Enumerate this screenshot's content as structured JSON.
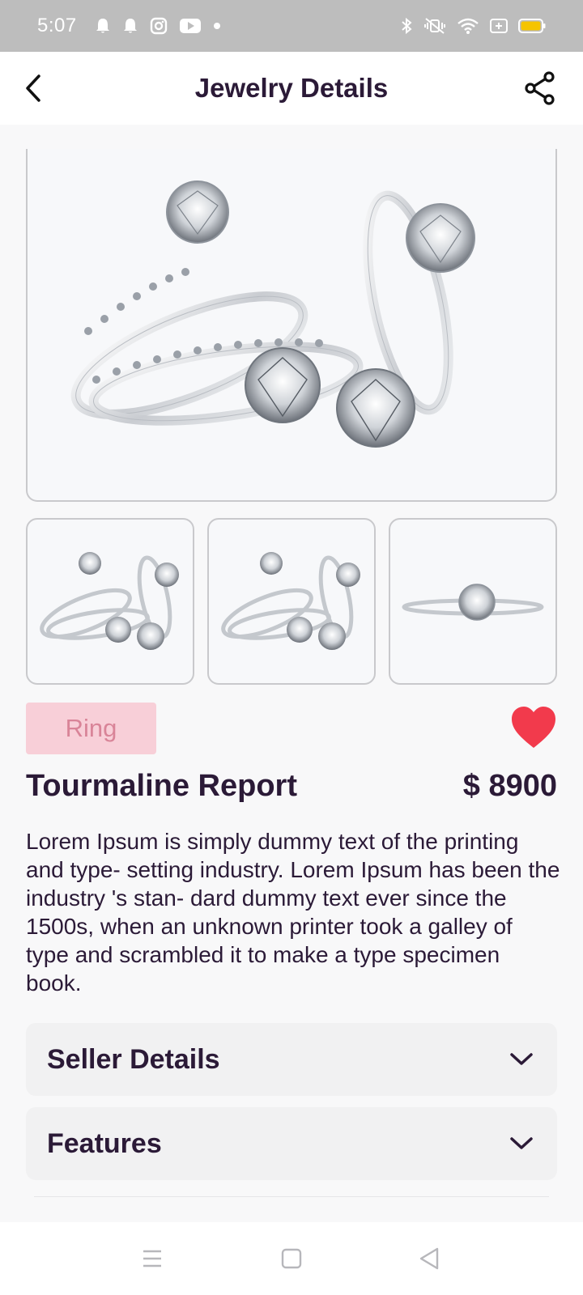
{
  "status_bar": {
    "time": "5:07",
    "left_icons": [
      "bell-icon",
      "bell-icon",
      "instagram-icon",
      "youtube-icon",
      "dot-icon"
    ],
    "right_icons": [
      "bluetooth-icon",
      "vibrate-off-icon",
      "wifi-icon",
      "sim-icon",
      "battery-icon"
    ],
    "battery_color": "#f5c400"
  },
  "app_bar": {
    "title": "Jewelry Details",
    "back_icon": "back-arrow-icon",
    "share_icon": "share-icon"
  },
  "product": {
    "category": "Ring",
    "name": "Tourmaline Report",
    "price": "$ 8900",
    "favorite": true,
    "favorite_color": "#f23a4c",
    "description": "Lorem Ipsum is simply dummy text of the printing and type- setting industry. Lorem Ipsum has been the industry 's stan- dard dummy text ever since the 1500s, when an unknown printer took a galley of type and scrambled it to make a type specimen book."
  },
  "sections": [
    {
      "label": "Seller Details",
      "icon": "chevron-down-icon"
    },
    {
      "label": "Features",
      "icon": "chevron-down-icon"
    }
  ],
  "nav_bar": [
    "menu-icon",
    "home-square-icon",
    "back-triangle-icon"
  ],
  "colors": {
    "primary_text": "#2b1a37",
    "tag_bg": "#f8cfd8",
    "tag_text": "#d98498",
    "status_bar_bg": "#bdbdbd"
  }
}
